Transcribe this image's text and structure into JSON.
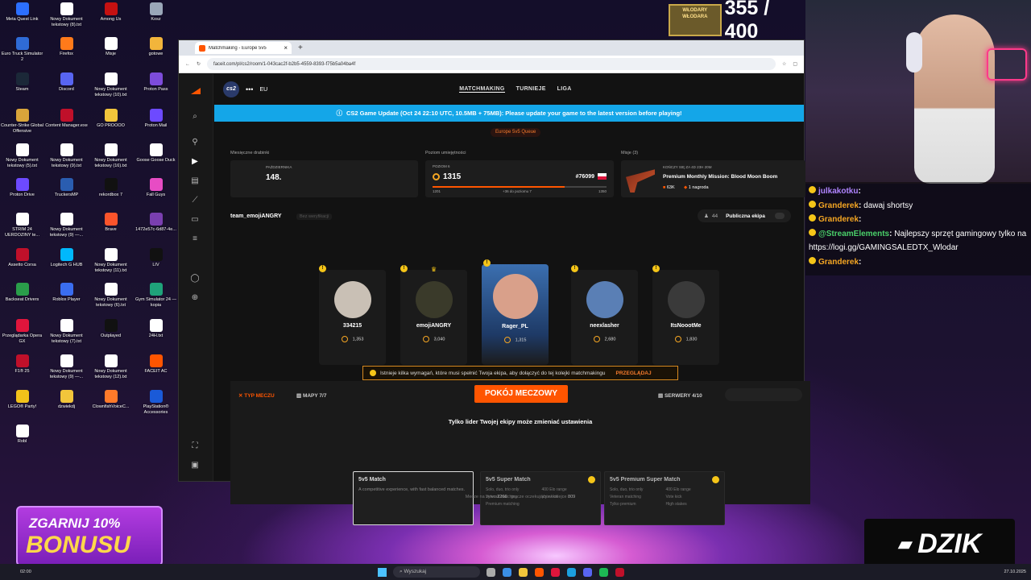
{
  "desktop": {
    "icons": [
      {
        "label": "Meta Quest Link",
        "color": "#2c6fff"
      },
      {
        "label": "Nowy Dokument tekstowy (8).txt",
        "color": "#ffffff"
      },
      {
        "label": "Among Us",
        "color": "#c51111"
      },
      {
        "label": "Kosz",
        "color": "#9aa7b8"
      },
      {
        "label": "Euro Truck Simulator 2",
        "color": "#2f6bd6"
      },
      {
        "label": "Firefox",
        "color": "#ff7a1a"
      },
      {
        "label": "Misje",
        "color": "#ffffff"
      },
      {
        "label": "gotowe",
        "color": "#f2b53b"
      },
      {
        "label": "Steam",
        "color": "#1b2838"
      },
      {
        "label": "Discord",
        "color": "#5865f2"
      },
      {
        "label": "Nowy Dokument tekstowy (10).txt",
        "color": "#ffffff"
      },
      {
        "label": "Proton Pass",
        "color": "#7d4cdb"
      },
      {
        "label": "Counter-Strike Global Offensive",
        "color": "#d9a53a"
      },
      {
        "label": "Content Manager.exe",
        "color": "#c0102a"
      },
      {
        "label": "GO PROOOO",
        "color": "#f2c53b"
      },
      {
        "label": "Proton Mail",
        "color": "#6d4aff"
      },
      {
        "label": "Nowy Dokument tekstowy (5).txt",
        "color": "#ffffff"
      },
      {
        "label": "Nowy Dokument tekstowy (9).txt",
        "color": "#ffffff"
      },
      {
        "label": "Nowy Dokument tekstowy (16).txt",
        "color": "#ffffff"
      },
      {
        "label": "Goose Goose Duck",
        "color": "#ffffff"
      },
      {
        "label": "Proton Drive",
        "color": "#6d4aff"
      },
      {
        "label": "TruckersMP",
        "color": "#2a5db0"
      },
      {
        "label": "rekordbox 7",
        "color": "#111111"
      },
      {
        "label": "Fall Guys",
        "color": "#e74cc4"
      },
      {
        "label": "STRIM 24 UERDOZINY te...",
        "color": "#ffffff"
      },
      {
        "label": "Nowy Dokument tekstowy (9) —...",
        "color": "#ffffff"
      },
      {
        "label": "Brave",
        "color": "#fb542b"
      },
      {
        "label": "1472e57c-6d87-4e...",
        "color": "#7a3fb0"
      },
      {
        "label": "Assetto Corsa",
        "color": "#c0102a"
      },
      {
        "label": "Logitech G HUB",
        "color": "#00b8fc"
      },
      {
        "label": "Nowy Dokument tekstowy (11).txt",
        "color": "#ffffff"
      },
      {
        "label": "LIV",
        "color": "#111111"
      },
      {
        "label": "Backseat Drivers",
        "color": "#2a9d4a"
      },
      {
        "label": "Roblox Player",
        "color": "#3a6df0"
      },
      {
        "label": "Nowy Dokument tekstowy (6).txt",
        "color": "#ffffff"
      },
      {
        "label": "Gym Simulator 24 — kopia",
        "color": "#1fa37a"
      },
      {
        "label": "Przeglądarka Opera GX",
        "color": "#e0153c"
      },
      {
        "label": "Nowy Dokument tekstowy (7).txt",
        "color": "#ffffff"
      },
      {
        "label": "Outplayed",
        "color": "#111111"
      },
      {
        "label": "24H.txt",
        "color": "#ffffff"
      },
      {
        "label": "F1® 25",
        "color": "#c0102a"
      },
      {
        "label": "Nowy Dokument tekstowy (9) —...",
        "color": "#ffffff"
      },
      {
        "label": "Nowy Dokument tekstowy (12).txt",
        "color": "#ffffff"
      },
      {
        "label": "FACEIT AC",
        "color": "#ff5500"
      },
      {
        "label": "LEGO® Party!",
        "color": "#f2c21a"
      },
      {
        "label": "dzwiekdj",
        "color": "#f2c53b"
      },
      {
        "label": "ClownfishVoiceC...",
        "color": "#ff7a2a"
      },
      {
        "label": "PlayStation® Accessories",
        "color": "#1a5ad8"
      },
      {
        "label": "Robl",
        "color": "#ffffff"
      }
    ]
  },
  "browser": {
    "tab_title": "Matchmaking - Europe 5v5",
    "new_tab": "+",
    "tab_close": "×",
    "url": "faceit.com/pl/cs2/room/1-043cac2f-b2b5-4559-8393-f75b5a04ba4f"
  },
  "faceit": {
    "game": "cs2",
    "region": "EU",
    "nav": [
      "MATCHMAKING",
      "TURNIEJE",
      "LIGA"
    ],
    "banner": "CS2 Game Update (Oct 24 22:10 UTC, 10.5MB + 75MB): Please update your game to the latest version before playing!",
    "queue": "Europe 5v5 Queue",
    "monthly": {
      "label": "Miesięczne drabinki",
      "month": "PAŹDZIERNIKA",
      "rank": "148."
    },
    "skill": {
      "label": "Poziom umiejętności",
      "level_label": "POZIOM 6",
      "elo": "1315",
      "rank_pos": "#76099",
      "min": "1201",
      "max": "1350",
      "to_next": "+36 do poziomu 7",
      "progress": 0.76
    },
    "missions": {
      "label": "Misje (3)",
      "ends": "KOŃCZY SIĘ ZA 4D 23H 20M",
      "title": "Premium Monthly Mission: Blood Moon Boom",
      "stat1": "63K",
      "stat2": "1 nagroda"
    },
    "party": {
      "name": "team_emojiANGRY",
      "unverified": "Bez weryfikacji",
      "count": "44",
      "public_label": "Publiczna ekipa"
    },
    "players": [
      {
        "name": "334215",
        "elo": "1,353"
      },
      {
        "name": "emojiANGRY",
        "elo": "3,040"
      },
      {
        "name": "Rager_PL",
        "elo": "1,315"
      },
      {
        "name": "neexlasher",
        "elo": "2,680"
      },
      {
        "name": "ItsNoootMe",
        "elo": "1,830"
      }
    ],
    "requirement": "Istnieje kilka wymagań, które musi spełnić Twoja ekipa, aby dołączyć do tej kolejki matchmakingu",
    "requirement_link": "PRZEGLĄDAJ",
    "tabs": {
      "match_type": "TYP MECZU",
      "maps": "MAPY 7/7",
      "servers": "SERWERY 4/10"
    },
    "room_button": "POKÓJ MECZOWY",
    "leader_note": "Tylko lider Twojej ekipy może zmieniać ustawienia",
    "modes": [
      {
        "title": "5v5 Match",
        "desc": "A competitive experience, with fast balanced matches."
      },
      {
        "title": "5v5 Super Match",
        "f1": "Solo, duo, trio only",
        "f2": "400 Elo range",
        "f3": "Veteran matching",
        "f4": "Vote kick",
        "f5": "Premium matching"
      },
      {
        "title": "5v5 Premium Super Match",
        "f1": "Solo, duo, trio only",
        "f2": "400 Elo range",
        "f3": "Veteran matching",
        "f4": "Vote kick",
        "f5": "Tylko premium",
        "f6": "High stakes"
      }
    ],
    "footer_live": "Mecze na żywo",
    "footer_live_val": "2266",
    "footer_wait": "gracze oczekujący w kolejce",
    "footer_wait_val": "809"
  },
  "stream": {
    "counter": "355 / 400",
    "counter_sign": "WŁODARY WŁODARA",
    "chat": [
      {
        "user": "julkakotku",
        "msg": "",
        "color": "#b084ff"
      },
      {
        "user": "Granderek",
        "msg": "dawaj shortsy",
        "color": "#f5a623"
      },
      {
        "user": "Granderek",
        "msg": "",
        "color": "#f5a623"
      },
      {
        "user": "@StreamElements",
        "msg": "Najlepszy sprzęt gamingowy tylko na https://logi.gg/GAMINGSALEDTX_Wlodar",
        "color": "#4ad06a"
      },
      {
        "user": "Granderek",
        "msg": "",
        "color": "#f5a623"
      }
    ],
    "bonus_top": "ZGARNIJ 10%",
    "bonus_main": "BONUSU",
    "sponsor": "DZIK"
  },
  "taskbar": {
    "search": "Wyszukaj",
    "time": "02:00",
    "date": "27.10.2025"
  }
}
